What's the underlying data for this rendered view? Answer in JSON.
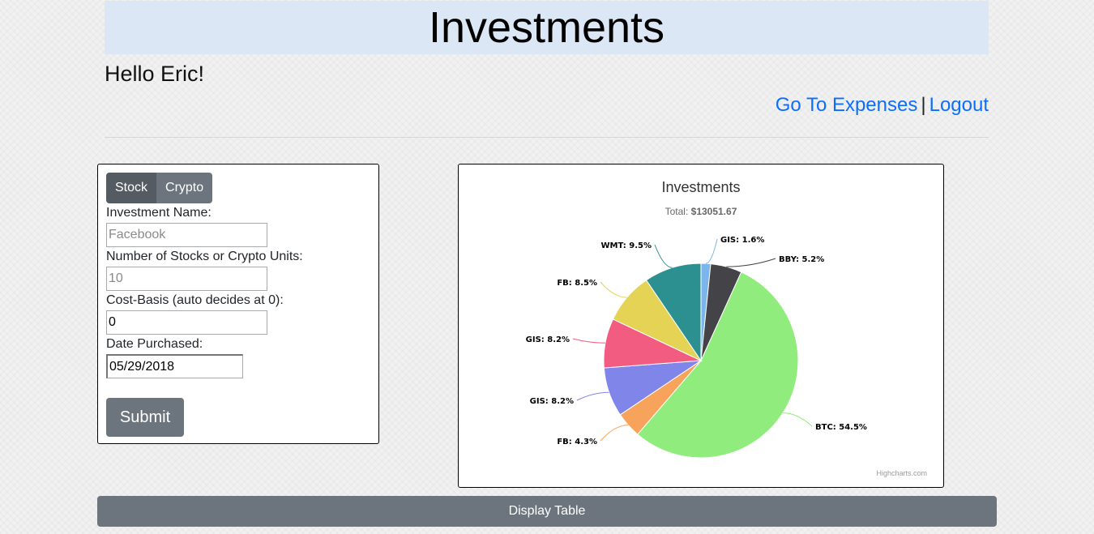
{
  "header": {
    "title": "Investments"
  },
  "greeting": "Hello Eric!",
  "nav": {
    "expenses_link": "Go To Expenses",
    "separator": "|",
    "logout_link": "Logout"
  },
  "form": {
    "toggle": {
      "stock_label": "Stock",
      "crypto_label": "Crypto",
      "active": "Stock"
    },
    "name_label": "Investment Name:",
    "name_placeholder": "Facebook",
    "units_label": "Number of Stocks or Crypto Units:",
    "units_placeholder": "10",
    "cost_label": "Cost-Basis (auto decides at 0):",
    "cost_value": "0",
    "date_label": "Date Purchased:",
    "date_value": "05/29/2018",
    "submit_label": "Submit"
  },
  "display_table_label": "Display Table",
  "colors": {
    "header_bg": "#dce7f6",
    "link": "#0d6efd",
    "button": "#6c757d",
    "button_active": "#545b62"
  },
  "chart_data": {
    "type": "pie",
    "title": "Investments",
    "subtitle_prefix": "Total: ",
    "subtitle_value": "$13051.67",
    "credits": "Highcharts.com",
    "slices": [
      {
        "label": "GIS: 1.6%",
        "value": 1.6,
        "color": "#7cb5ec"
      },
      {
        "label": "BBY: 5.2%",
        "value": 5.2,
        "color": "#434348"
      },
      {
        "label": "BTC: 54.5%",
        "value": 54.5,
        "color": "#90ed7d"
      },
      {
        "label": "FB: 4.3%",
        "value": 4.3,
        "color": "#f7a35c"
      },
      {
        "label": "GIS: 8.2%",
        "value": 8.2,
        "color": "#8085e9"
      },
      {
        "label": "GIS: 8.2%",
        "value": 8.2,
        "color": "#f15c80"
      },
      {
        "label": "FB: 8.5%",
        "value": 8.5,
        "color": "#e4d354"
      },
      {
        "label": "WMT: 9.5%",
        "value": 9.5,
        "color": "#2b908f"
      }
    ]
  }
}
